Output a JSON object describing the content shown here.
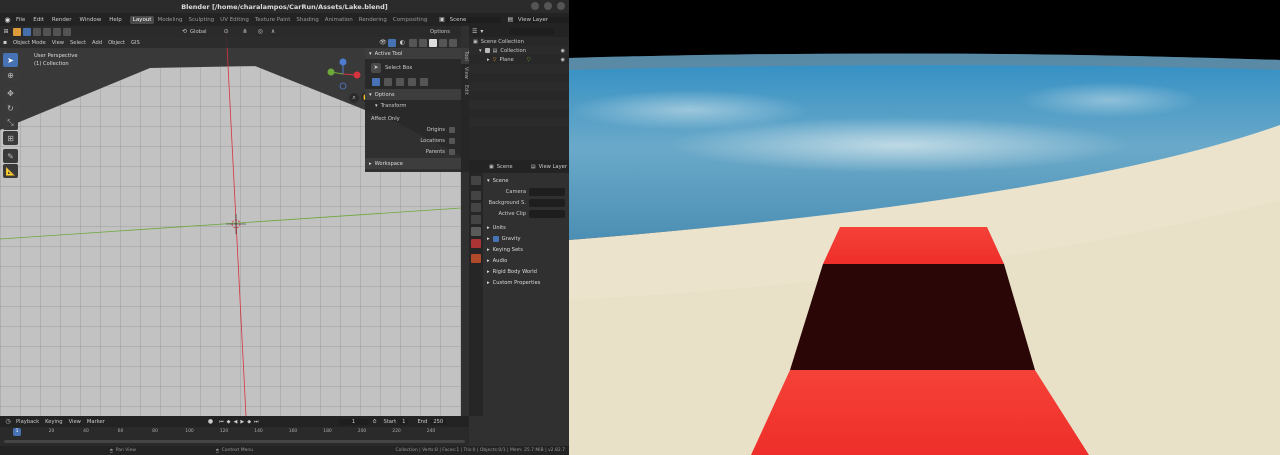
{
  "window": {
    "title": "Blender [/home/charalampos/CarRun/Assets/Lake.blend]"
  },
  "menus": [
    "File",
    "Edit",
    "Render",
    "Window",
    "Help"
  ],
  "workspaces": [
    "Layout",
    "Modeling",
    "Sculpting",
    "UV Editing",
    "Texture Paint",
    "Shading",
    "Animation",
    "Rendering",
    "Compositing"
  ],
  "active_workspace": "Layout",
  "scene_selector": "Scene",
  "view_layer_selector": "View Layer",
  "viewport": {
    "mode": "Object Mode",
    "menus": [
      "View",
      "Select",
      "Add",
      "Object",
      "GIS"
    ],
    "transform_orientation": "Global",
    "options_label": "Options",
    "info_line1": "User Perspective",
    "info_line2": "(1) Collection"
  },
  "npanel": {
    "active_tool_title": "Active Tool",
    "tool_name": "Select Box",
    "options_title": "Options",
    "transform_title": "Transform",
    "affect_only": "Affect Only",
    "origins": "Origins",
    "locations": "Locations",
    "parents": "Parents",
    "workspace_title": "Workspace",
    "tabs": [
      "Tool",
      "View",
      "Edit"
    ]
  },
  "outliner": {
    "root": "Scene Collection",
    "collection": "Collection",
    "plane": "Plane"
  },
  "properties": {
    "scene_label": "Scene",
    "view_layer_label": "View Layer",
    "section_scene": "Scene",
    "camera_label": "Camera",
    "background_label": "Background S.",
    "active_clip_label": "Active Clip",
    "sections": [
      "Units",
      "Gravity",
      "Keying Sets",
      "Audio",
      "Rigid Body World",
      "Custom Properties"
    ]
  },
  "timeline": {
    "menus": [
      "Playback",
      "Keying",
      "View",
      "Marker"
    ],
    "current_frame": "1",
    "start_label": "Start",
    "start_value": "1",
    "end_label": "End",
    "end_value": "250",
    "ticks": [
      "1",
      "20",
      "40",
      "60",
      "80",
      "100",
      "120",
      "140",
      "160",
      "180",
      "200",
      "220",
      "240"
    ]
  },
  "statusbar": {
    "pan_view": "Pan View",
    "context_menu": "Context Menu",
    "stats": "Collection | Verts:8 | Faces:1 | Tris:0 | Objects:0/1 | Mem: 25.7 MiB | v2.82.7"
  },
  "colors": {
    "accent": "#4772b3",
    "x_axis": "#d7333f",
    "y_axis": "#6ca83a",
    "red_car": "#f73a35",
    "dark_window": "#2a0606",
    "sand": "#ece3cd",
    "water": "#3c8fb8"
  }
}
